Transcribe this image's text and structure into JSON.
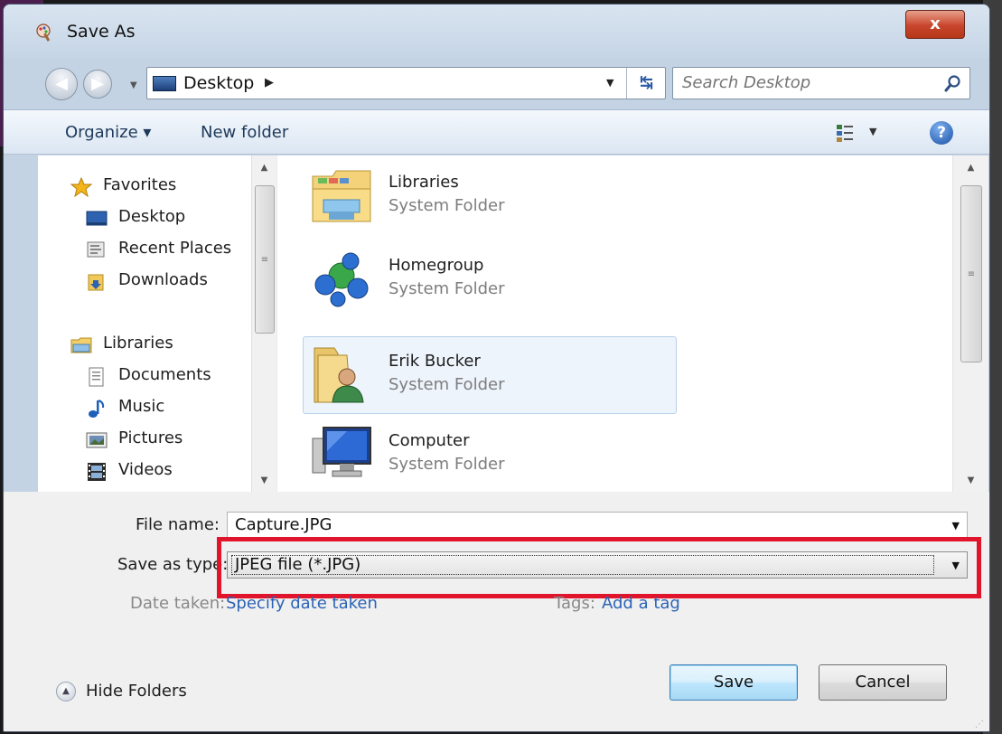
{
  "window": {
    "title": "Save As",
    "close_label": "x"
  },
  "address": {
    "location": "Desktop",
    "search_placeholder": "Search Desktop"
  },
  "toolbar": {
    "organize": "Organize ▾",
    "new_folder": "New folder"
  },
  "nav_pane": {
    "items": [
      {
        "label": "Favorites",
        "icon": "star-icon"
      },
      {
        "label": "Desktop",
        "icon": "desktop-icon"
      },
      {
        "label": "Recent Places",
        "icon": "recent-places-icon"
      },
      {
        "label": "Downloads",
        "icon": "downloads-icon"
      },
      {
        "label": "Libraries",
        "icon": "libraries-icon"
      },
      {
        "label": "Documents",
        "icon": "documents-icon"
      },
      {
        "label": "Music",
        "icon": "music-icon"
      },
      {
        "label": "Pictures",
        "icon": "pictures-icon"
      },
      {
        "label": "Videos",
        "icon": "videos-icon"
      }
    ]
  },
  "files": [
    {
      "name": "Libraries",
      "type": "System Folder",
      "icon": "libraries-folder-icon"
    },
    {
      "name": "Homegroup",
      "type": "System Folder",
      "icon": "homegroup-icon"
    },
    {
      "name": "Erik Bucker",
      "type": "System Folder",
      "icon": "user-folder-icon"
    },
    {
      "name": "Computer",
      "type": "System Folder",
      "icon": "computer-icon"
    }
  ],
  "form": {
    "file_name_label": "File name:",
    "file_name_value": "Capture.JPG",
    "save_type_label": "Save as type:",
    "save_type_value": "JPEG file (*.JPG)",
    "date_taken_label": "Date taken:",
    "date_taken_link": "Specify date taken",
    "tags_label": "Tags:",
    "tags_link": "Add a tag"
  },
  "footer": {
    "hide_folders": "Hide Folders",
    "save": "Save",
    "cancel": "Cancel"
  },
  "colors": {
    "highlight_box": "#e0142b",
    "link": "#2c63b5",
    "selection": "#edf4fb"
  }
}
